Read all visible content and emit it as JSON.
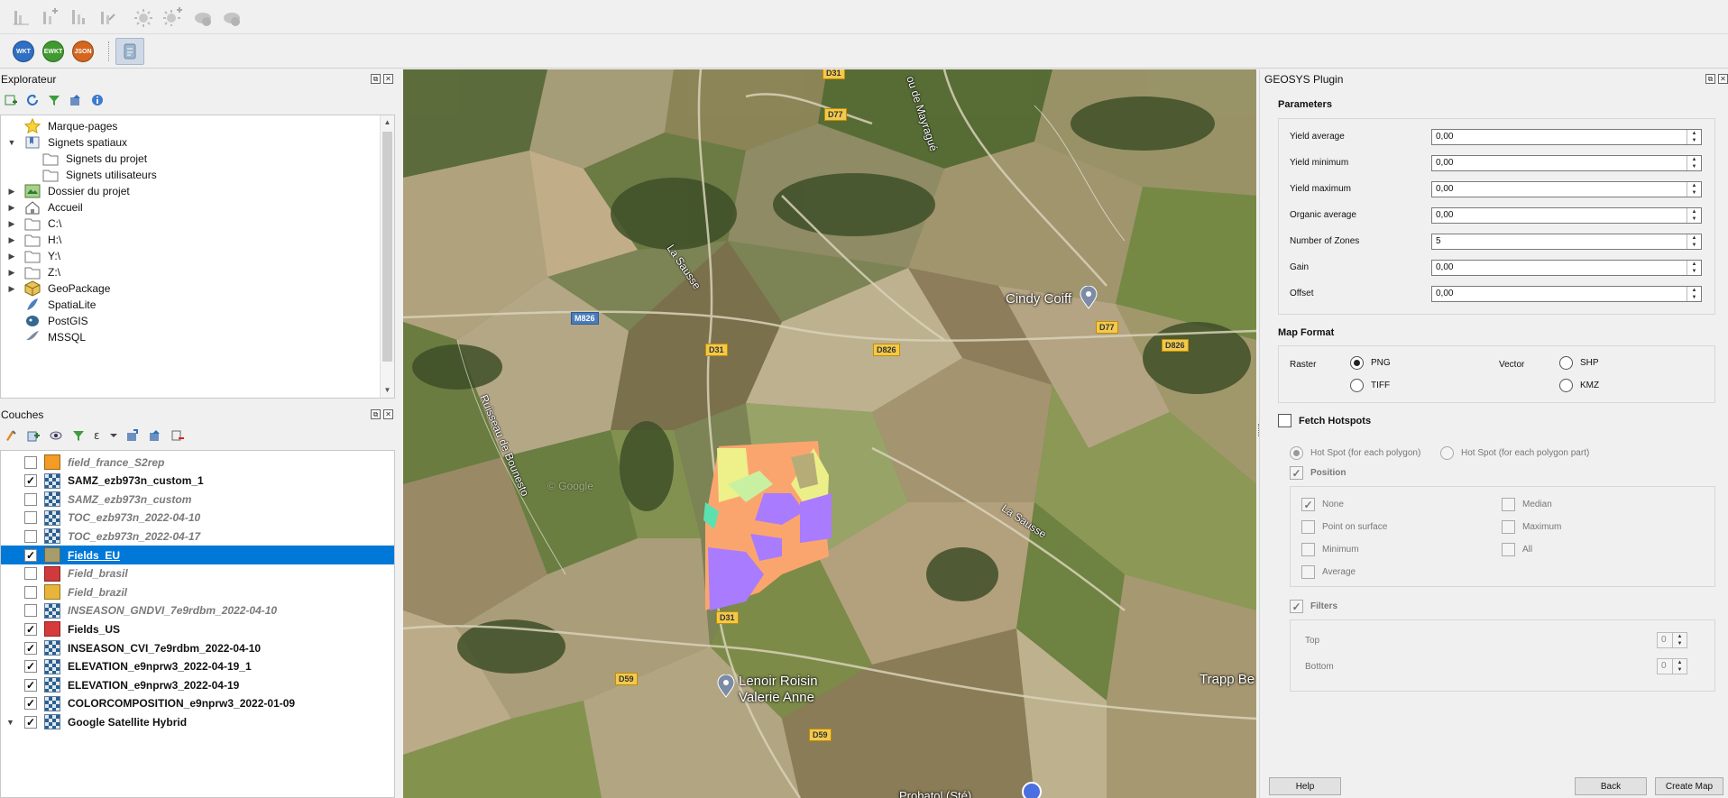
{
  "toolbar1": {
    "icons": [
      "chart-icon",
      "chart-add-icon",
      "chart-bar-icon",
      "chart-edit-icon",
      "weather-sun-icon",
      "weather-sun-add-icon",
      "cloud-download-icon",
      "cloud-refresh-icon"
    ]
  },
  "toolbar2": {
    "wkt": "WKT",
    "ewkt": "EWKT",
    "json": "JSON"
  },
  "explorer": {
    "title": "Explorateur",
    "items": [
      {
        "label": "Marque-pages",
        "icon": "star-icon",
        "expand": ""
      },
      {
        "label": "Signets spatiaux",
        "icon": "bookmark-icon",
        "expand": "▼"
      },
      {
        "label": "Signets du projet",
        "icon": "folder-icon",
        "expand": ""
      },
      {
        "label": "Signets utilisateurs",
        "icon": "folder-icon",
        "expand": ""
      },
      {
        "label": "Dossier du projet",
        "icon": "project-folder-icon",
        "expand": "▶"
      },
      {
        "label": "Accueil",
        "icon": "home-icon",
        "expand": "▶"
      },
      {
        "label": "C:\\",
        "icon": "folder-icon",
        "expand": "▶"
      },
      {
        "label": "H:\\",
        "icon": "folder-icon",
        "expand": "▶"
      },
      {
        "label": "Y:\\",
        "icon": "folder-icon",
        "expand": "▶"
      },
      {
        "label": "Z:\\",
        "icon": "folder-icon",
        "expand": "▶"
      },
      {
        "label": "GeoPackage",
        "icon": "geopackage-icon",
        "expand": "▶"
      },
      {
        "label": "SpatiaLite",
        "icon": "spatialite-icon",
        "expand": ""
      },
      {
        "label": "PostGIS",
        "icon": "postgis-icon",
        "expand": ""
      },
      {
        "label": "MSSQL",
        "icon": "mssql-icon",
        "expand": ""
      }
    ]
  },
  "layers_panel": {
    "title": "Couches",
    "layers": [
      {
        "name": "field_france_S2rep",
        "checked": "",
        "type": "swatch",
        "color": "#f29b25",
        "style": "gray"
      },
      {
        "name": "SAMZ_ezb973n_custom_1",
        "checked": "✓",
        "type": "raster",
        "color": "",
        "style": "bold"
      },
      {
        "name": "SAMZ_ezb973n_custom",
        "checked": "",
        "type": "raster",
        "color": "",
        "style": "gray"
      },
      {
        "name": "TOC_ezb973n_2022-04-10",
        "checked": "",
        "type": "raster",
        "color": "",
        "style": "gray"
      },
      {
        "name": "TOC_ezb973n_2022-04-17",
        "checked": "",
        "type": "raster",
        "color": "",
        "style": "gray"
      },
      {
        "name": "Fields_EU",
        "checked": "✓",
        "type": "swatch",
        "color": "#a59d6c",
        "style": "sel"
      },
      {
        "name": "Field_brasil",
        "checked": "",
        "type": "swatch",
        "color": "#d03a3a",
        "style": "gray"
      },
      {
        "name": "Field_brazil",
        "checked": "",
        "type": "swatch",
        "color": "#e8b43a",
        "style": "gray"
      },
      {
        "name": "INSEASON_GNDVI_7e9rdbm_2022-04-10",
        "checked": "",
        "type": "raster",
        "color": "",
        "style": "gray"
      },
      {
        "name": "Fields_US",
        "checked": "✓",
        "type": "swatch",
        "color": "#d63a3a",
        "style": "bold"
      },
      {
        "name": "INSEASON_CVI_7e9rdbm_2022-04-10",
        "checked": "✓",
        "type": "raster",
        "color": "",
        "style": "bold"
      },
      {
        "name": "ELEVATION_e9nprw3_2022-04-19_1",
        "checked": "✓",
        "type": "raster",
        "color": "",
        "style": "bold"
      },
      {
        "name": "ELEVATION_e9nprw3_2022-04-19",
        "checked": "✓",
        "type": "raster",
        "color": "",
        "style": "bold"
      },
      {
        "name": "COLORCOMPOSITION_e9nprw3_2022-01-09",
        "checked": "✓",
        "type": "raster",
        "color": "",
        "style": "bold"
      },
      {
        "name": "Google Satellite Hybrid",
        "checked": "✓",
        "type": "raster",
        "color": "",
        "style": "bold"
      }
    ]
  },
  "map": {
    "roads": [
      "D31",
      "D77",
      "M826",
      "D31",
      "D826",
      "D77",
      "D826",
      "D31",
      "D59",
      "D59"
    ],
    "places": [
      "Cindy Coiff",
      "Lenoir Roisin",
      "Valerie Anne",
      "Trapp Be",
      "Probatol (Sté)"
    ],
    "streets": [
      "La Sausse",
      "Ruisseau de Bounesto",
      "La Sausse",
      "ou de Mayragué"
    ],
    "watermark": "© Google"
  },
  "plugin": {
    "title": "GEOSYS Plugin",
    "parameters_label": "Parameters",
    "params": [
      {
        "label": "Yield average",
        "value": "0,00"
      },
      {
        "label": "Yield minimum",
        "value": "0,00"
      },
      {
        "label": "Yield maximum",
        "value": "0,00"
      },
      {
        "label": "Organic average",
        "value": "0,00"
      },
      {
        "label": "Number of Zones",
        "value": "5"
      },
      {
        "label": "Gain",
        "value": "0,00"
      },
      {
        "label": "Offset",
        "value": "0,00"
      }
    ],
    "map_format_label": "Map Format",
    "raster_label": "Raster",
    "vector_label": "Vector",
    "png": "PNG",
    "tiff": "TIFF",
    "shp": "SHP",
    "kmz": "KMZ",
    "fetch_hotspots": "Fetch Hotspots",
    "hotspot_polygon": "Hot Spot (for each polygon)",
    "hotspot_part": "Hot Spot (for each polygon part)",
    "position_label": "Position",
    "none": "None",
    "median": "Median",
    "point_on_surface": "Point on surface",
    "maximum": "Maximum",
    "minimum": "Minimum",
    "all": "All",
    "average": "Average",
    "filters_label": "Filters",
    "top_label": "Top",
    "top_value": "0",
    "bottom_label": "Bottom",
    "bottom_value": "0",
    "help": "Help",
    "back": "Back",
    "create_map": "Create Map"
  }
}
